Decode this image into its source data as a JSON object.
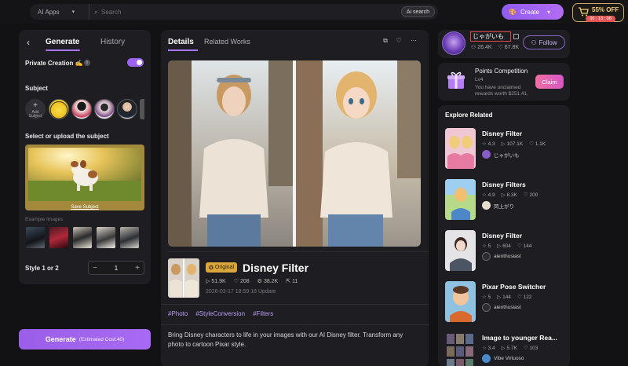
{
  "topbar": {
    "app_select": "AI Apps",
    "search_placeholder": "Search",
    "ai_search": "Ai search",
    "create": "Create",
    "promo": "55% OFF",
    "timer": "00 : 13 : 08"
  },
  "left": {
    "tab_generate": "Generate",
    "tab_history": "History",
    "private_label": "Private Creation",
    "subject_label": "Subject",
    "add_subject": "Add Subject",
    "select_label": "Select or upload the subject",
    "save_subject": "Save Subject",
    "example_label": "Example Images",
    "style_label": "Style 1 or 2",
    "stepper_value": "1",
    "generate_label": "Generate",
    "generate_cost": "(Estimated Cost:40)"
  },
  "center": {
    "tab_details": "Details",
    "tab_related": "Related Works",
    "badge": "Original",
    "title": "Disney Filter",
    "stats": {
      "views": "51.9K",
      "likes": "208",
      "uses": "38.2K",
      "shares": "11"
    },
    "date": "2026-03-17 18:59:18 Update",
    "tags": [
      "#Photo",
      "#StyleConversion",
      "#Filters"
    ],
    "description": "Bring Disney characters to life in your images with our AI Disney filter. Transform any photo to cartoon Pixar style."
  },
  "creator": {
    "name": "じゃがいも",
    "followers": "26.4K",
    "likes": "67.8K",
    "follow": "Follow"
  },
  "points": {
    "title": "Points Competition",
    "level": "Lv4",
    "sub": "You have unclaimed rewards worth $251.41.",
    "claim": "Claim"
  },
  "explore": {
    "title": "Explore Related",
    "items": [
      {
        "name": "Disney Filter",
        "rating": "4.3",
        "uses": "107.1K",
        "likes": "1.1K",
        "author": "じゃがいも"
      },
      {
        "name": "Disney Filters",
        "rating": "4.9",
        "uses": "8.3K",
        "likes": "200",
        "author": "罔上がり"
      },
      {
        "name": "Disney Filter",
        "rating": "5",
        "uses": "604",
        "likes": "144",
        "author": "aienthusiast"
      },
      {
        "name": "Pixar Pose Switcher",
        "rating": "5",
        "uses": "144",
        "likes": "122",
        "author": "aienthusiast"
      },
      {
        "name": "Image to younger Rea...",
        "rating": "3.4",
        "uses": "5.7K",
        "likes": "103",
        "author": "Vibe Virtuoso"
      }
    ]
  },
  "colors": {
    "accent": "#a872f5",
    "background": "#121214",
    "panel": "#1e1e22",
    "promo": "#f5cf7b",
    "badge": "#d9a63b"
  }
}
